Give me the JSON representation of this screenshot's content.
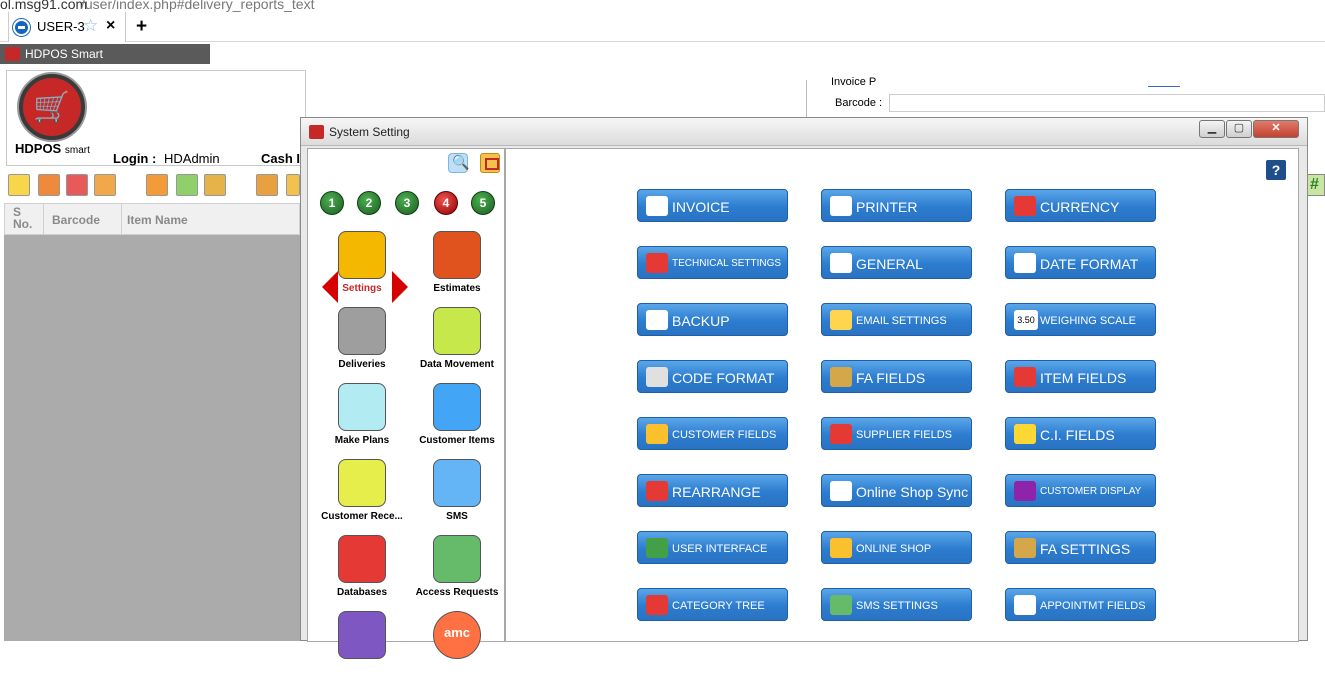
{
  "browser": {
    "url_host": "ol.msg91.com",
    "url_path": "/user/index.php#delivery_reports_text",
    "tab_title": "USER-3",
    "tab_close": "×",
    "new_tab": "+"
  },
  "main_window": {
    "title": "HDPOS Smart",
    "logo_text": "HDPOS",
    "logo_suffix": "smart",
    "login_label": "Login :",
    "login_value": "HDAdmin",
    "cash_label": "Cash I",
    "grid_headers": {
      "sno": "S No.",
      "barcode": "Barcode",
      "item_name": "Item Name"
    }
  },
  "background_panel": {
    "invoice_label": "Invoice P",
    "barcode_label": "Barcode :"
  },
  "system_setting": {
    "title": "System Setting",
    "window_buttons": {
      "minimize": "▁",
      "maximize": "▢",
      "close": "✕"
    },
    "help": "?",
    "pages": [
      "1",
      "2",
      "3",
      "4",
      "5"
    ],
    "active_page": "4",
    "sidebar": [
      {
        "label": "Settings",
        "icon": "settings-icon",
        "color": "#f5b800",
        "active": true
      },
      {
        "label": "Estimates",
        "icon": "estimates-icon",
        "color": "#e0531f"
      },
      {
        "label": "Deliveries",
        "icon": "deliveries-icon",
        "color": "#9e9e9e"
      },
      {
        "label": "Data Movement",
        "icon": "data-movement-icon",
        "color": "#c6e84a"
      },
      {
        "label": "Make Plans",
        "icon": "make-plans-icon",
        "color": "#b2ebf2"
      },
      {
        "label": "Customer Items",
        "icon": "customer-items-icon",
        "color": "#42a5f5"
      },
      {
        "label": "Customer Rece...",
        "icon": "customer-receipts-icon",
        "color": "#e6ee4c"
      },
      {
        "label": "SMS",
        "icon": "sms-icon",
        "color": "#64b5f6"
      },
      {
        "label": "Databases",
        "icon": "databases-icon",
        "color": "#e53935"
      },
      {
        "label": "Access Requests",
        "icon": "access-requests-icon",
        "color": "#66bb6a"
      },
      {
        "label": "",
        "icon": "clock-icon",
        "color": "#7e57c2"
      },
      {
        "label": "amc",
        "icon": "amc-icon",
        "color": "#ff7043"
      }
    ],
    "buttons": [
      [
        {
          "label": "INVOICE",
          "icon": "invoice-icon",
          "icon_color": "#ffffff",
          "size": "normal"
        },
        {
          "label": "PRINTER",
          "icon": "printer-icon",
          "icon_color": "#ffffff",
          "size": "normal"
        },
        {
          "label": "CURRENCY",
          "icon": "currency-icon",
          "icon_color": "#e53935",
          "size": "normal"
        }
      ],
      [
        {
          "label": "TECHNICAL SETTINGS",
          "icon": "technical-settings-icon",
          "icon_color": "#e53935",
          "size": "tiny"
        },
        {
          "label": "GENERAL",
          "icon": "gear-icon",
          "icon_color": "#ffffff",
          "size": "normal"
        },
        {
          "label": "DATE FORMAT",
          "icon": "calendar-icon",
          "icon_color": "#ffffff",
          "size": "normal"
        }
      ],
      [
        {
          "label": "BACKUP",
          "icon": "backup-icon",
          "icon_color": "#ffffff",
          "size": "normal"
        },
        {
          "label": "EMAIL SETTINGS",
          "icon": "email-icon",
          "icon_color": "#ffd54f",
          "size": "small"
        },
        {
          "label": "WEIGHING SCALE",
          "icon": "weighing-scale-icon",
          "icon_color": "#ffffff",
          "icon_text": "3.50",
          "size": "small"
        }
      ],
      [
        {
          "label": "CODE FORMAT",
          "icon": "code-format-icon",
          "icon_color": "#e0e0e0",
          "size": "normal"
        },
        {
          "label": "FA FIELDS",
          "icon": "fa-fields-icon",
          "icon_color": "#d4a84a",
          "size": "normal"
        },
        {
          "label": "ITEM FIELDS",
          "icon": "item-fields-icon",
          "icon_color": "#e53935",
          "size": "normal"
        }
      ],
      [
        {
          "label": "CUSTOMER FIELDS",
          "icon": "customer-fields-icon",
          "icon_color": "#fbc02d",
          "size": "small"
        },
        {
          "label": "SUPPLIER FIELDS",
          "icon": "supplier-fields-icon",
          "icon_color": "#e53935",
          "size": "small"
        },
        {
          "label": "C.I. FIELDS",
          "icon": "ci-fields-icon",
          "icon_color": "#fdd835",
          "size": "normal"
        }
      ],
      [
        {
          "label": "REARRANGE",
          "icon": "rearrange-icon",
          "icon_color": "#e53935",
          "size": "normal"
        },
        {
          "label": "Online Shop Synch",
          "icon": "online-shop-synch-icon",
          "icon_color": "#ffffff",
          "size": "normal"
        },
        {
          "label": "CUSTOMER DISPLAY",
          "icon": "customer-display-icon",
          "icon_color": "#8e24aa",
          "size": "tiny"
        }
      ],
      [
        {
          "label": "USER INTERFACE",
          "icon": "user-interface-icon",
          "icon_color": "#43a047",
          "size": "small"
        },
        {
          "label": "ONLINE SHOP",
          "icon": "globe-icon",
          "icon_color": "#fbc02d",
          "size": "small"
        },
        {
          "label": "FA SETTINGS",
          "icon": "fa-settings-icon",
          "icon_color": "#d4a84a",
          "size": "normal"
        }
      ],
      [
        {
          "label": "CATEGORY TREE",
          "icon": "category-tree-icon",
          "icon_color": "#e53935",
          "size": "small"
        },
        {
          "label": "SMS SETTINGS",
          "icon": "sms-settings-icon",
          "icon_color": "#66bb6a",
          "size": "small"
        },
        {
          "label": "APPOINTMT FIELDS",
          "icon": "appointment-fields-icon",
          "icon_color": "#ffffff",
          "size": "small"
        }
      ]
    ]
  }
}
